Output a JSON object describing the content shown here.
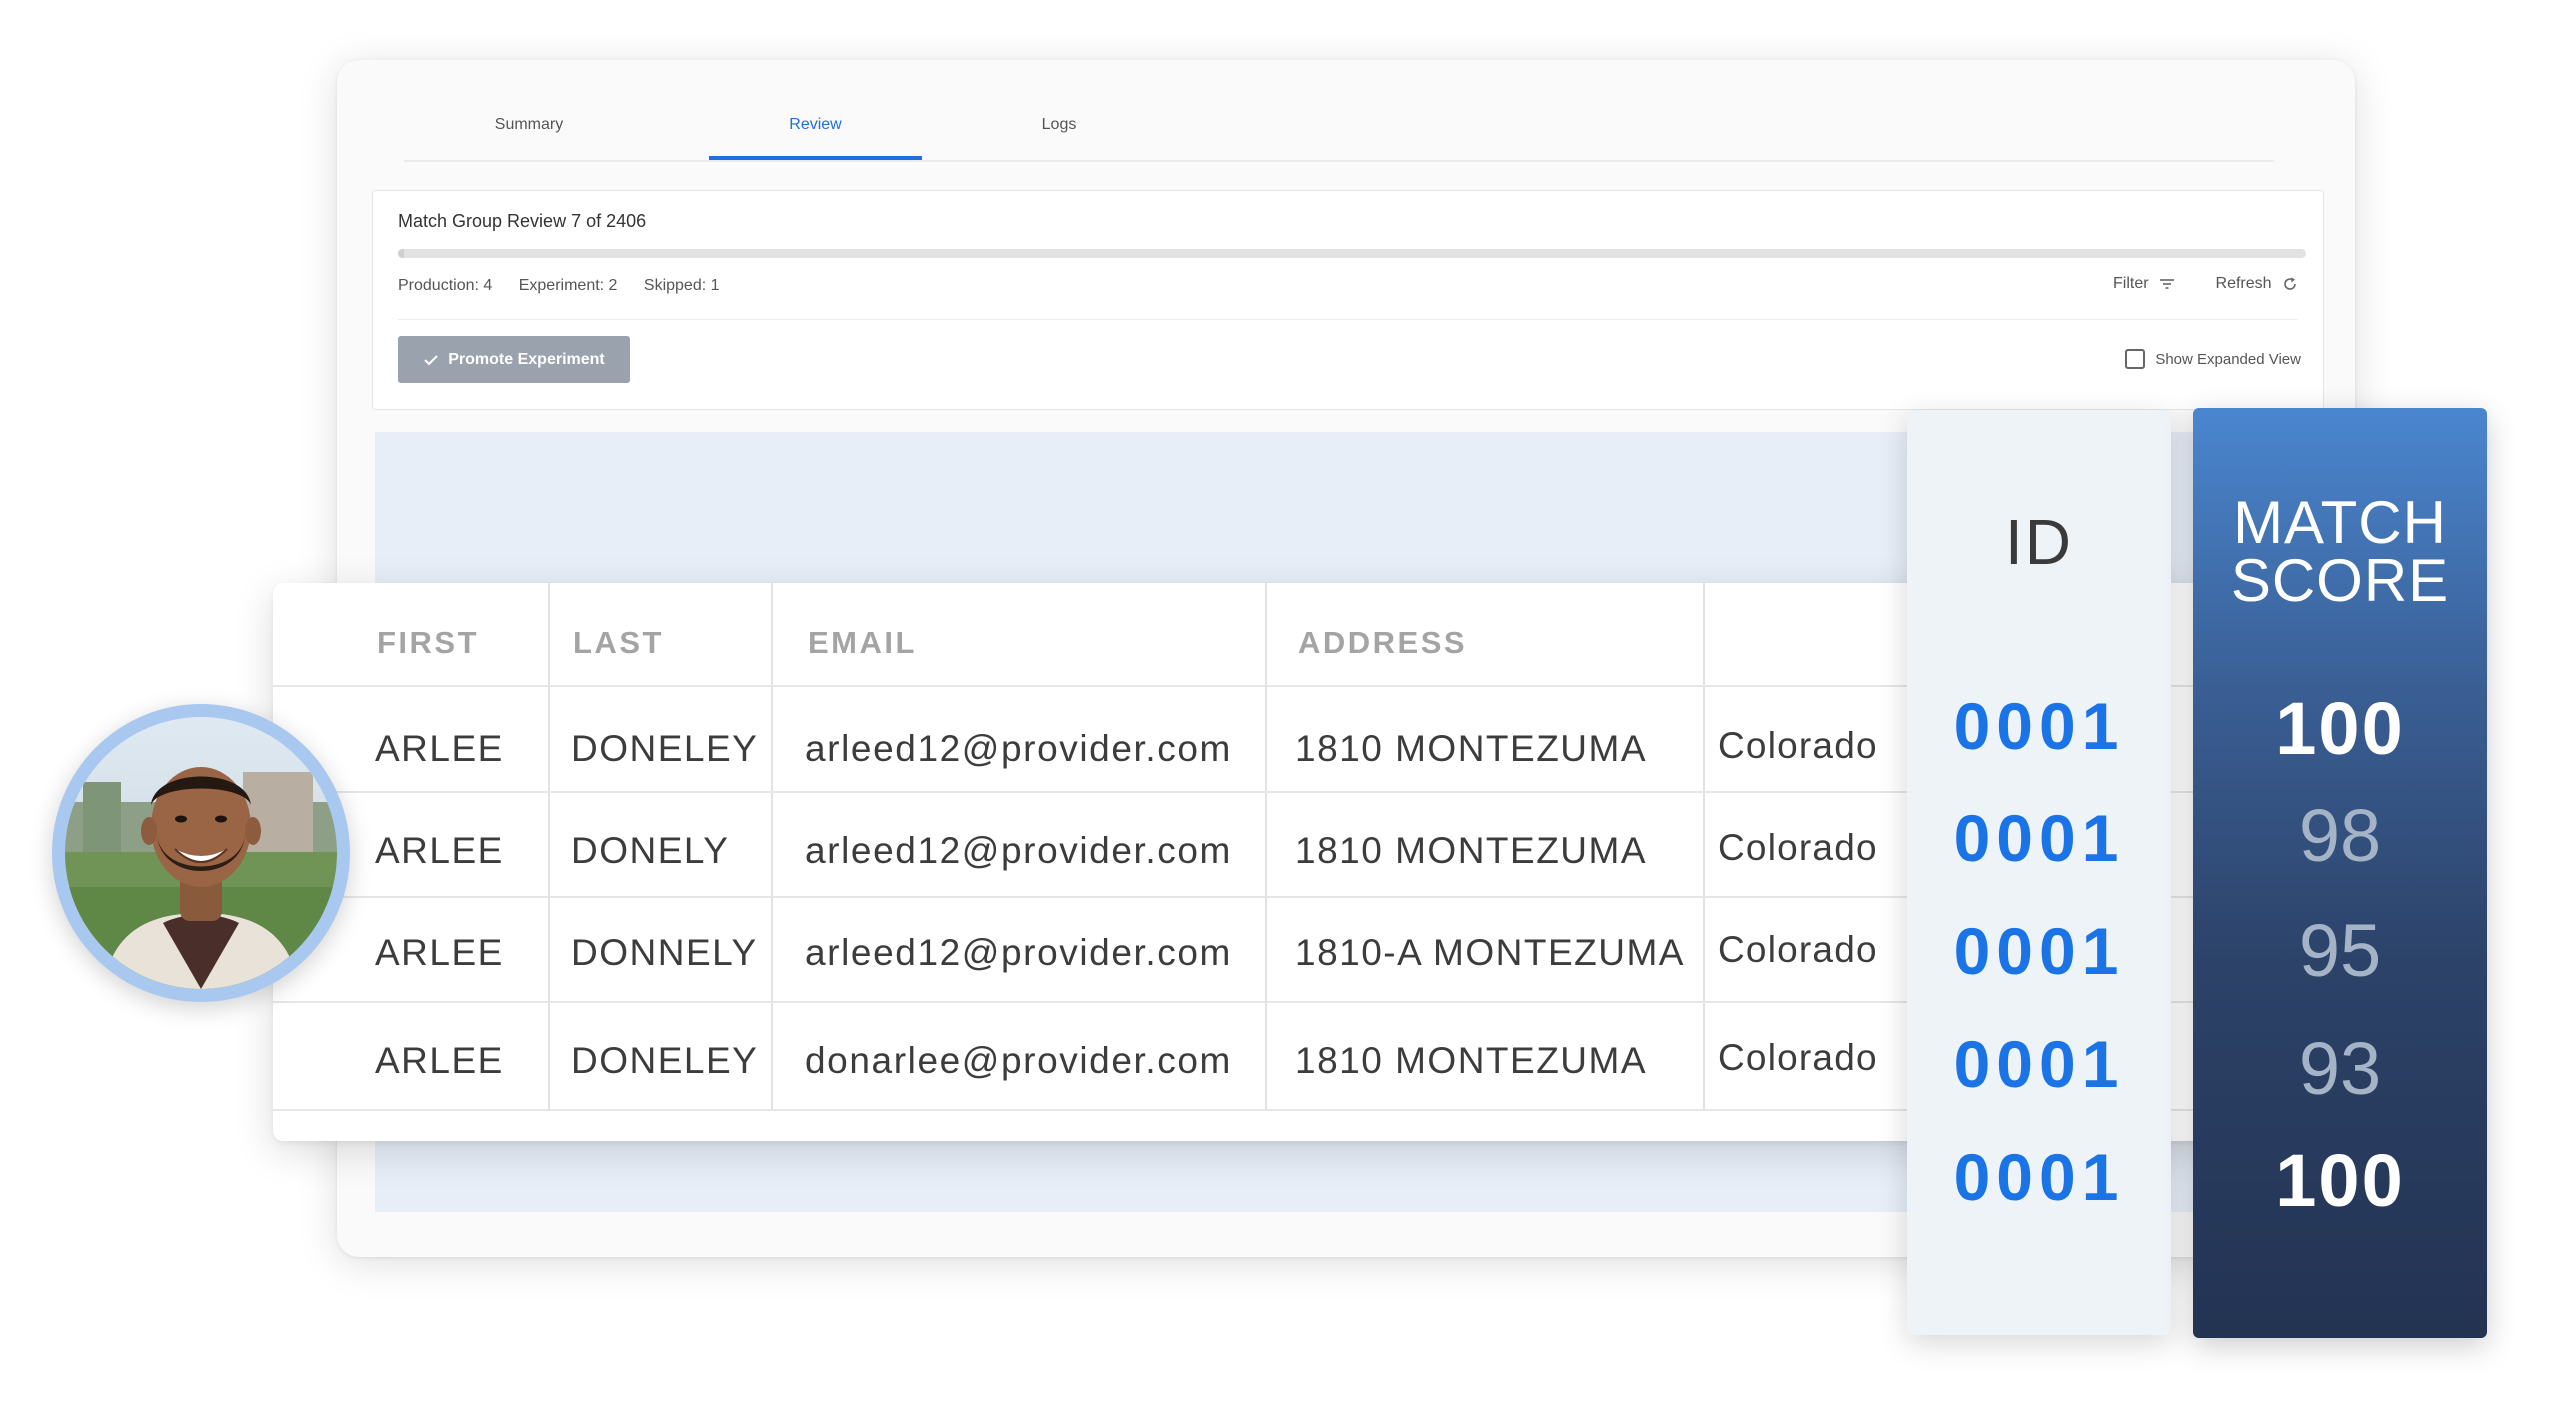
{
  "tabs": [
    {
      "label": "Summary"
    },
    {
      "label": "Review",
      "active": true
    },
    {
      "label": "Logs"
    }
  ],
  "review_panel": {
    "title": "Match Group Review 7 of 2406",
    "progress": {
      "current": 7,
      "total": 2406
    },
    "stats": {
      "production": "Production: 4",
      "experiment": "Experiment: 2",
      "skipped": "Skipped: 1"
    },
    "filter_label": "Filter",
    "refresh_label": "Refresh",
    "promote_label": "Promote Experiment",
    "expanded_view_label": "Show Expanded View",
    "expanded_view_checked": false
  },
  "records_table": {
    "headers": [
      "FIRST",
      "LAST",
      "EMAIL",
      "ADDRESS"
    ],
    "rows": [
      {
        "first": "ARLEE",
        "last": "DONELEY",
        "email": "arleed12@provider.com",
        "address": "1810 MONTEZUMA",
        "state": "Colorado"
      },
      {
        "first": "ARLEE",
        "last": "DONELY",
        "email": "arleed12@provider.com",
        "address": "1810 MONTEZUMA",
        "state": "Colorado"
      },
      {
        "first": "ARLEE",
        "last": "DONNELY",
        "email": "arleed12@provider.com",
        "address": "1810-A MONTEZUMA",
        "state": "Colorado"
      },
      {
        "first": "ARLEE",
        "last": "DONELEY",
        "email": "donarlee@provider.com",
        "address": "1810 MONTEZUMA",
        "state": "Colorado"
      }
    ]
  },
  "id_column": {
    "title": "ID",
    "values": [
      "0001",
      "0001",
      "0001",
      "0001",
      "0001"
    ]
  },
  "match_score": {
    "title_line1": "MATCH",
    "title_line2": "SCORE",
    "values": [
      "100",
      "98",
      "95",
      "93",
      "100"
    ]
  },
  "colors": {
    "accent": "#1e6fe0",
    "id_blue": "#1a74e6",
    "score_top": "#4a86cf",
    "score_bottom": "#233352",
    "highlight_bg": "#e7eef8"
  },
  "icons": {
    "filter": "filter-icon",
    "refresh": "refresh-icon",
    "check": "check-icon",
    "avatar": "user-avatar-photo"
  }
}
